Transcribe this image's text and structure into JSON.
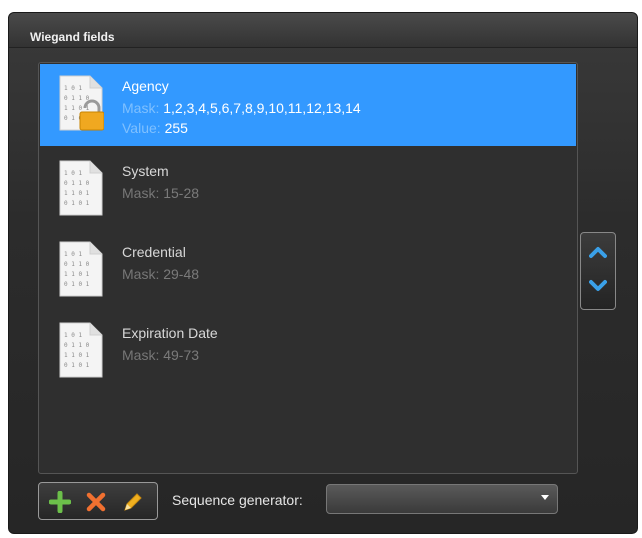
{
  "panel": {
    "title": "Wiegand fields"
  },
  "fields": [
    {
      "name": "Agency",
      "mask_label": "Mask:",
      "mask": "1,2,3,4,5,6,7,8,9,10,11,12,13,14",
      "value_label": "Value:",
      "value": "255",
      "locked": true,
      "selected": true
    },
    {
      "name": "System",
      "mask_label": "Mask:",
      "mask": "15-28",
      "locked": false,
      "selected": false
    },
    {
      "name": "Credential",
      "mask_label": "Mask:",
      "mask": "29-48",
      "locked": false,
      "selected": false
    },
    {
      "name": "Expiration Date",
      "mask_label": "Mask:",
      "mask": "49-73",
      "locked": false,
      "selected": false
    }
  ],
  "toolbar": {
    "add_icon": "plus-icon",
    "delete_icon": "x-icon",
    "edit_icon": "pencil-icon"
  },
  "sequence": {
    "label": "Sequence generator:",
    "selected": ""
  },
  "colors": {
    "selection": "#3399ff",
    "add": "#6cc04a",
    "delete": "#f07030",
    "edit": "#f0b020",
    "arrow": "#3aa0e8"
  }
}
